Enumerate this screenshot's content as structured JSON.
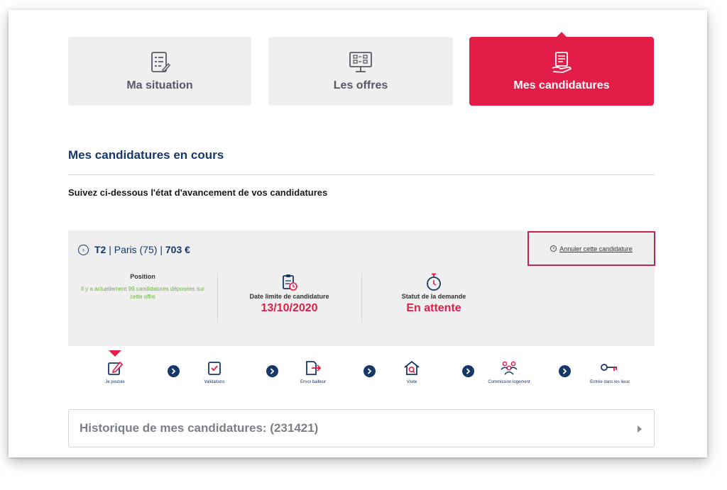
{
  "tabs": [
    {
      "label": "Ma situation",
      "icon": "checklist-icon"
    },
    {
      "label": "Les offres",
      "icon": "offers-board-icon"
    },
    {
      "label": "Mes candidatures",
      "icon": "document-hand-icon",
      "active": true
    }
  ],
  "section": {
    "title": "Mes candidatures en cours",
    "subtitle": "Suivez ci-dessous l'état d'avancement de vos candidatures"
  },
  "offer": {
    "type": "T2",
    "location": "Paris (75)",
    "price": "703 €",
    "cancel_label": "Annuler cette candidature"
  },
  "position": {
    "label": "Position",
    "text": "Il y a actuellement 99 candidatures déposées sur cette offre"
  },
  "deadline": {
    "label": "Date limite de candidature",
    "value": "13/10/2020"
  },
  "status": {
    "label": "Statut de la demande",
    "value": "En attente"
  },
  "steps": [
    {
      "label": "Je postule",
      "icon": "pencil-edit-icon"
    },
    {
      "label": "Validations",
      "icon": "checkbox-icon"
    },
    {
      "label": "Envoi bailleur",
      "icon": "send-document-icon"
    },
    {
      "label": "Visite",
      "icon": "house-search-icon"
    },
    {
      "label": "Commission logement",
      "icon": "people-group-icon"
    },
    {
      "label": "Entrée dans les lieux",
      "icon": "key-icon"
    }
  ],
  "history": {
    "label": "Historique de mes candidatures: (231421)"
  },
  "colors": {
    "accent": "#e11d48",
    "navy": "#16386b",
    "green": "#6cb33f"
  }
}
